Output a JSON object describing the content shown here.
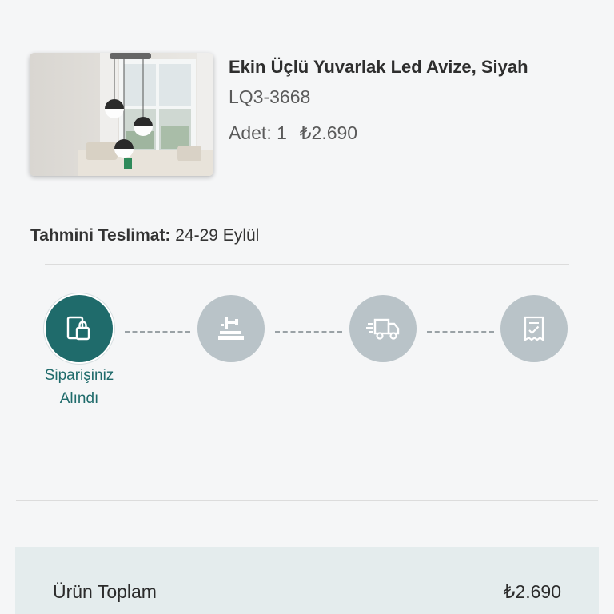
{
  "product": {
    "title": "Ekin Üçlü Yuvarlak Led Avize, Siyah",
    "sku": "LQ3-3668",
    "quantity_label": "Adet: 1",
    "price": "₺2.690",
    "image_icon": "pendant-lamp-photo"
  },
  "delivery": {
    "label": "Tahmini Teslimat:",
    "value": "24-29 Eylül"
  },
  "steps": [
    {
      "icon": "order-received-icon",
      "active": true,
      "label_line1": "Siparişiniz",
      "label_line2": "Alındı"
    },
    {
      "icon": "preparing-icon",
      "active": false
    },
    {
      "icon": "shipping-truck-icon",
      "active": false
    },
    {
      "icon": "delivered-receipt-icon",
      "active": false
    }
  ],
  "summary": {
    "label": "Ürün Toplam",
    "value": "₺2.690"
  },
  "colors": {
    "accent": "#1f6b6b",
    "step_inactive": "#b9c3c8",
    "summary_bg": "#e4eced",
    "page_bg": "#f5f6f7"
  }
}
